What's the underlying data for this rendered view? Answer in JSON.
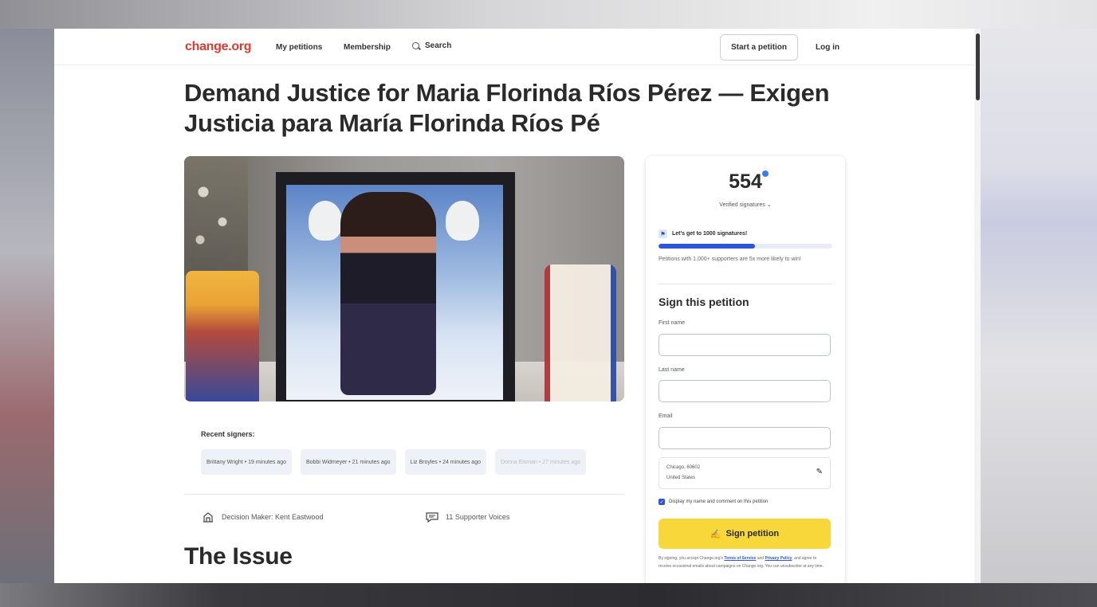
{
  "nav": {
    "logo": "change.org",
    "my_petitions": "My petitions",
    "membership": "Membership",
    "search": "Search",
    "start_petition": "Start a petition",
    "login": "Log in"
  },
  "petition": {
    "title": "Demand Justice for Maria Florinda Ríos Pérez — Exigen Justicia para María Florinda Ríos Pé",
    "recent_signers_label": "Recent signers:",
    "recent_signers": [
      "Brittany Wright • 19 minutes ago",
      "Bobbi Widmeyer • 21 minutes ago",
      "Liz Broyles • 24 minutes ago",
      "Donna Eisman • 27 minutes ago"
    ],
    "decision_maker": "Decision Maker: Kent Eastwood",
    "supporter_voices": "11 Supporter Voices",
    "issue_heading": "The Issue"
  },
  "panel": {
    "signature_count": "554",
    "verified_label": "Verified signatures",
    "goal_text": "Let's get to 1000 signatures!",
    "progress_fraction": 0.554,
    "goal_note": "Petitions with 1,000+ supporters are 5x more likely to win!",
    "sign_title": "Sign this petition",
    "first_name_label": "First name",
    "last_name_label": "Last name",
    "email_label": "Email",
    "location_line1": "Chicago, 60602",
    "location_line2": "United States",
    "display_checkbox_label": "Display my name and comment on this petition",
    "sign_button": "Sign petition",
    "fine_print_prefix": "By signing, you accept Change.org's",
    "terms_link": "Terms of Service",
    "and_text": "and",
    "privacy_link": "Privacy Policy",
    "fine_print_suffix": ", and agree to receive occasional emails about campaigns on Change.org. You can unsubscribe at any time."
  },
  "colors": {
    "brand_red": "#e03a2f",
    "progress_blue": "#2e56d6",
    "sign_button_yellow": "#f8d73b"
  },
  "icons": {
    "search": "search-icon",
    "chevron": "chevron-down-icon",
    "decision_maker": "building-icon",
    "voices": "speech-bubble-icon",
    "pencil": "pencil-icon"
  }
}
